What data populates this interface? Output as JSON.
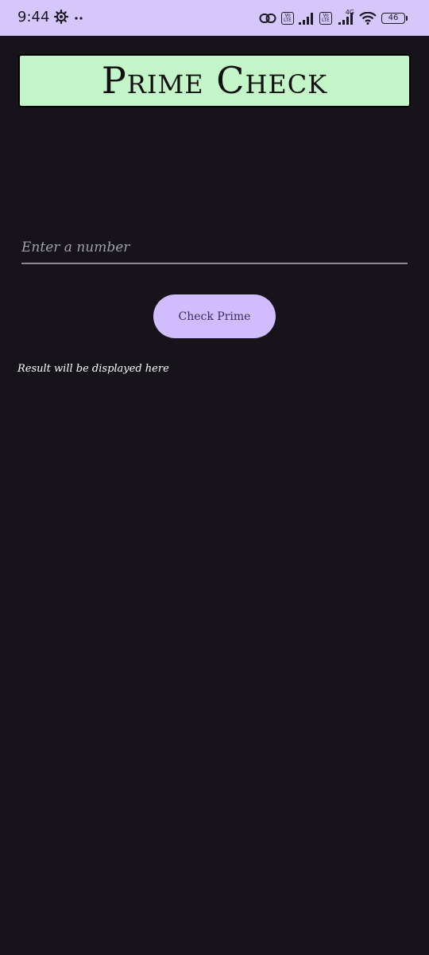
{
  "status_bar": {
    "time": "9:44",
    "network_type": "4G",
    "volte_label": "Vo LTE",
    "battery_level": "46",
    "background_color": "#d5c6fb"
  },
  "app": {
    "title": "Prime Check",
    "title_background_color": "#c4f5c8",
    "background_color": "#16141a"
  },
  "input": {
    "placeholder": "Enter a number",
    "value": ""
  },
  "button": {
    "label": "Check Prime",
    "color": "#d0bcfe"
  },
  "result": {
    "text": "Result will be displayed here"
  }
}
